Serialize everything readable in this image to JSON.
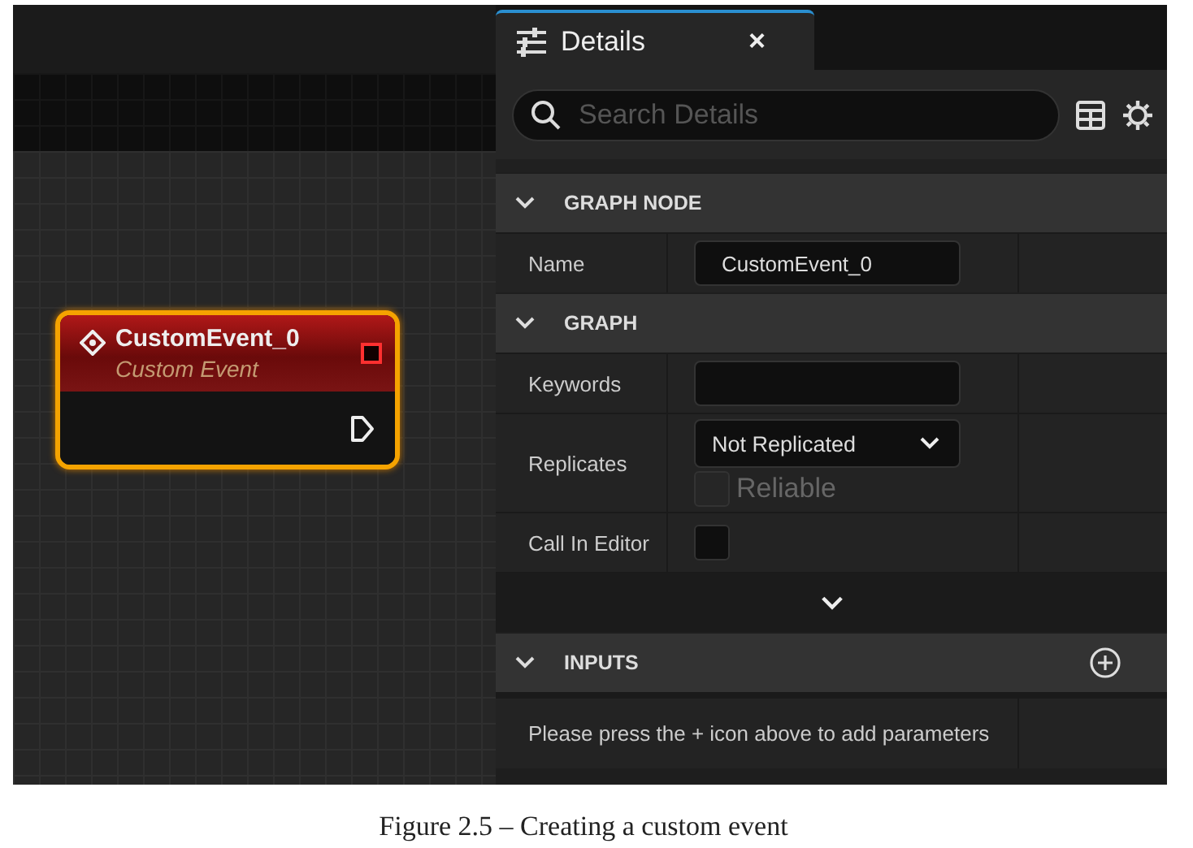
{
  "graph": {
    "node": {
      "title": "CustomEvent_0",
      "subtitle": "Custom Event",
      "selected": true
    }
  },
  "details": {
    "tab": {
      "title": "Details",
      "close": "×"
    },
    "search": {
      "placeholder": "Search Details"
    },
    "sections": [
      {
        "title": "GRAPH NODE",
        "expanded": true,
        "rows": [
          {
            "kind": "text",
            "label": "Name",
            "value": "CustomEvent_0"
          }
        ]
      },
      {
        "title": "GRAPH",
        "expanded": true,
        "advanced_toggle": true,
        "rows": [
          {
            "kind": "text",
            "label": "Keywords"
          },
          {
            "kind": "dropdown",
            "label": "Replicates",
            "value": "Not Replicated",
            "option": {
              "label": "Reliable",
              "checked": false,
              "disabled": true
            }
          },
          {
            "kind": "checkbox",
            "label": "Call In Editor",
            "checked": false
          }
        ]
      },
      {
        "title": "INPUTS",
        "expanded": true,
        "add_button": true,
        "message": "Please press the + icon above to add parameters"
      }
    ]
  },
  "caption": "Figure 2.5 – Creating a custom event"
}
